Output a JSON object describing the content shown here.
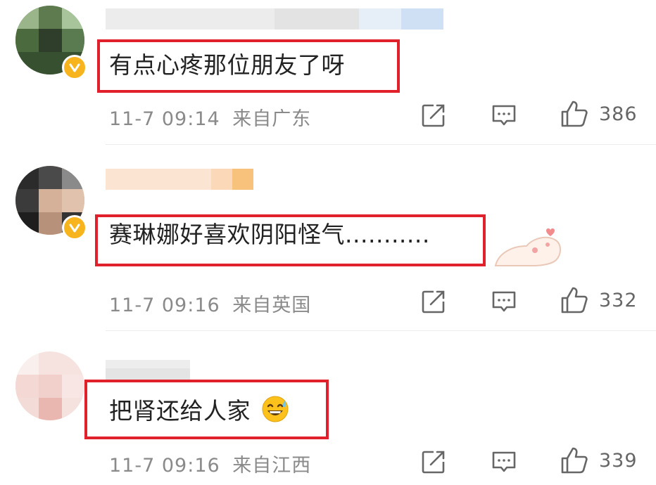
{
  "comments": [
    {
      "text": "有点心疼那位朋友了呀",
      "time": "11-7 09:14",
      "location": "来自广东",
      "likes": "386"
    },
    {
      "text": "赛琳娜好喜欢阴阳怪气...........",
      "time": "11-7 09:16",
      "location": "来自英国",
      "likes": "332"
    },
    {
      "text": "把肾还给人家",
      "time": "11-7 09:16",
      "location": "来自江西",
      "likes": "339"
    }
  ],
  "icons": {
    "share": "share-icon",
    "reply": "comment-icon",
    "like": "thumbs-up-icon",
    "verified": "verified-badge-icon",
    "emoji": "sweat-smile-emoji"
  },
  "colors": {
    "highlight": "#e0202b",
    "badge": "#f7b41c",
    "meta": "#8a8a8a"
  }
}
